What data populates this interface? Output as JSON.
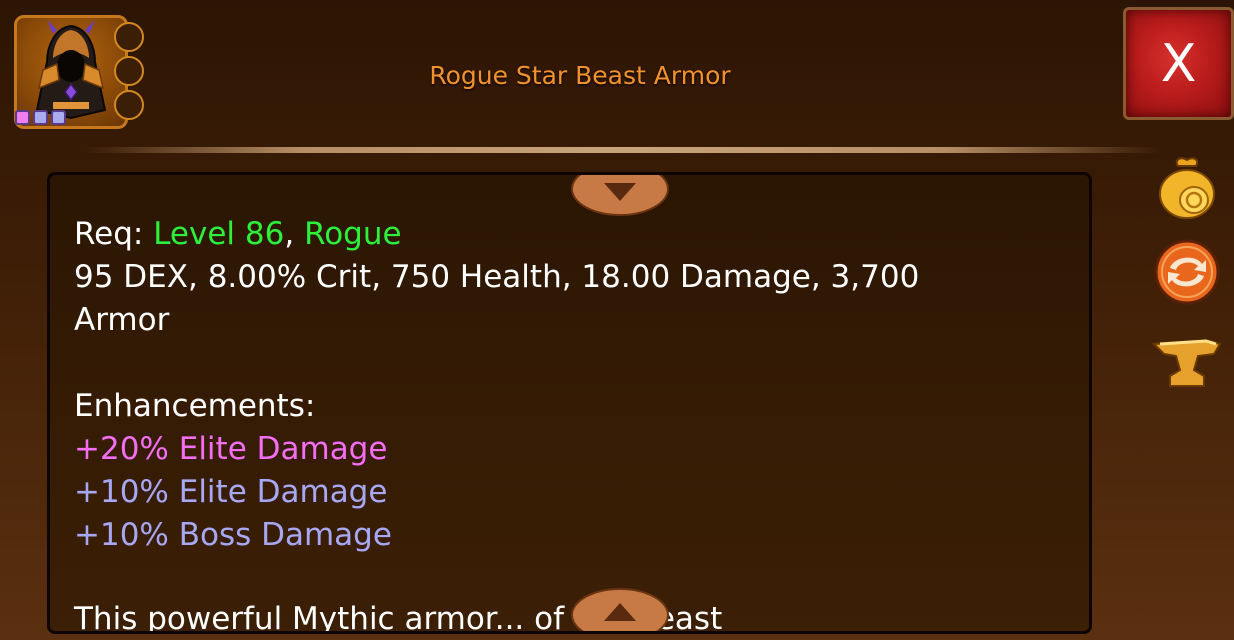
{
  "item": {
    "name": "Rogue Star Beast Armor",
    "icon": "hooded-armor-icon",
    "sockets": [
      "#f07ff0",
      "#aaaaee",
      "#aaaaee"
    ]
  },
  "close_label": "X",
  "side_icons": [
    "gold-coin-bag-icon",
    "swap-arrows-icon",
    "anvil-icon"
  ],
  "details": {
    "req_label": "Req:",
    "level": "Level 86",
    "class": "Rogue",
    "stats_line1": "95 DEX, 8.00% Crit, 750 Health, 18.00 Damage, 3,700",
    "stats_line2": "Armor",
    "enhancements_label": "Enhancements:",
    "enhancements": [
      "+20% Elite Damage",
      "+10% Elite Damage",
      "+10% Boss Damage"
    ],
    "description_partial": "This powerful Mythic armor... of the Beast"
  },
  "colors": {
    "title": "#f2922c",
    "requirement": "#2cf03a",
    "enhancement_major": "#f36ef5",
    "enhancement_minor": "#a7a8f4"
  }
}
